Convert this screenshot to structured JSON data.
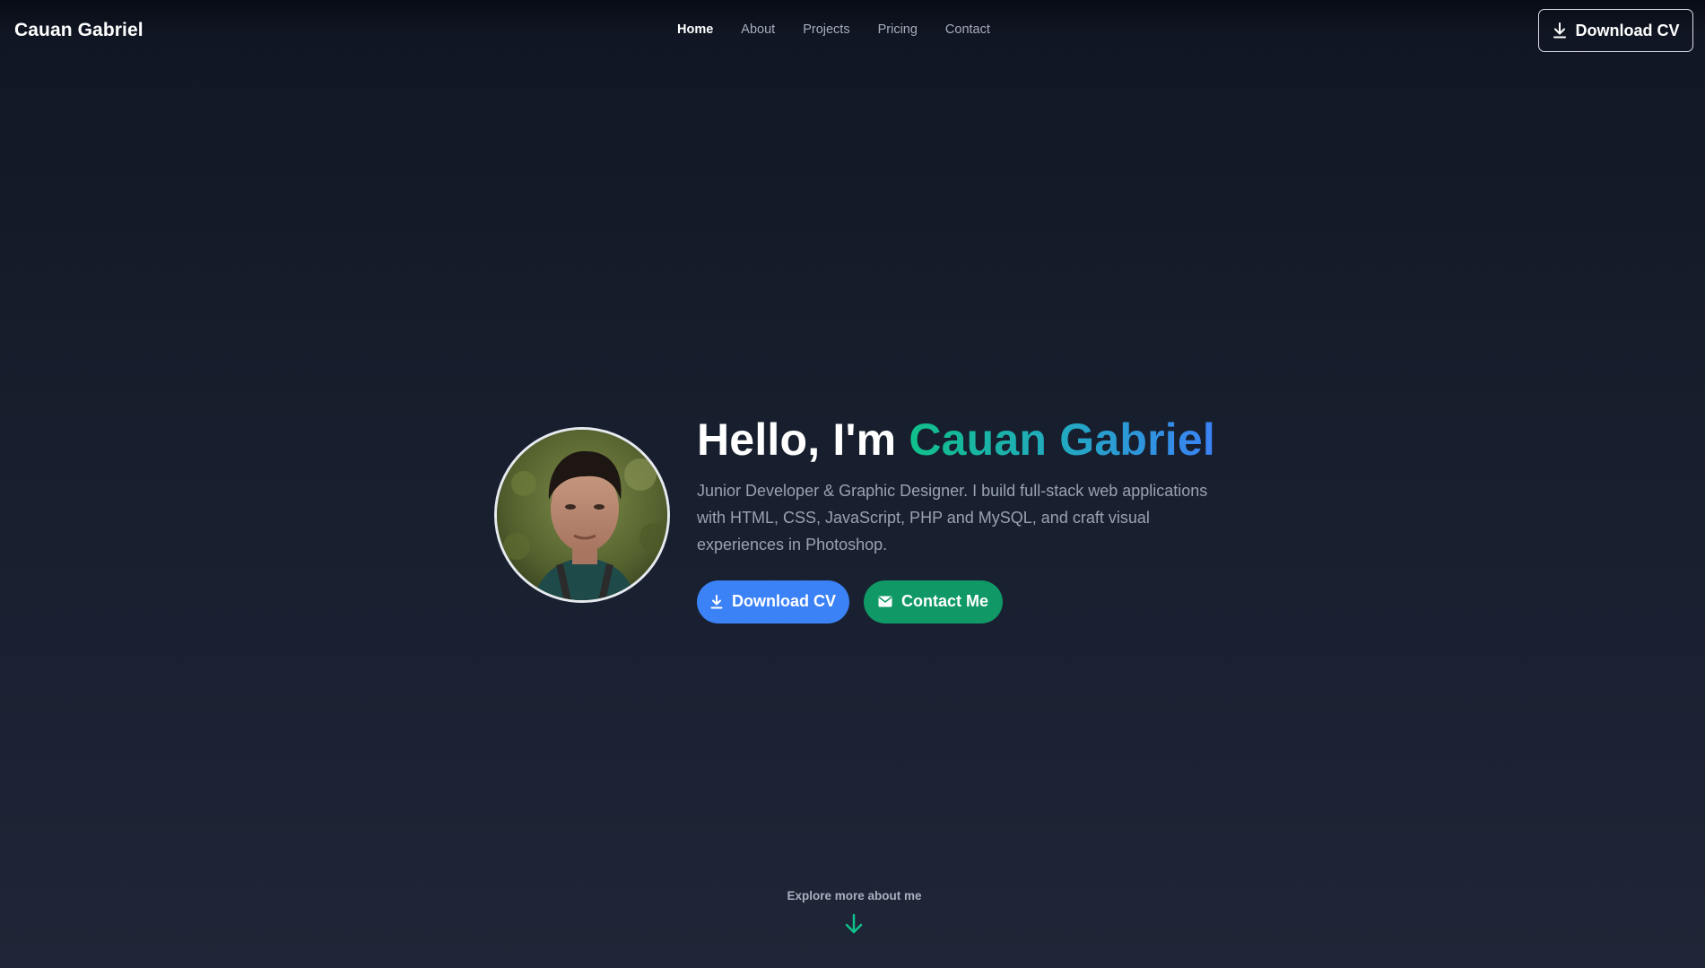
{
  "nav": {
    "brand": "Cauan Gabriel",
    "links": [
      {
        "label": "Home",
        "active": true
      },
      {
        "label": "About",
        "active": false
      },
      {
        "label": "Projects",
        "active": false
      },
      {
        "label": "Pricing",
        "active": false
      },
      {
        "label": "Contact",
        "active": false
      }
    ],
    "cv_button": {
      "label": "Download CV",
      "icon": "download-icon"
    }
  },
  "hero": {
    "greeting": "Hello, I'm ",
    "name": "Cauan Gabriel",
    "description": "Junior Developer & Graphic Designer. I build full-stack web applications with HTML, CSS, JavaScript, PHP and MySQL, and craft visual experiences in Photoshop.",
    "avatar": "profile-photo",
    "buttons": {
      "download_cv": {
        "label": "Download CV",
        "icon": "download-icon",
        "color": "#3b82f6"
      },
      "contact_me": {
        "label": "Contact Me",
        "icon": "mail-icon",
        "color": "#109866"
      }
    }
  },
  "footer_hint": {
    "label": "Explore more about me",
    "icon": "arrow-down-icon",
    "color": "#10c08a"
  },
  "colors": {
    "accent_green": "#10c08a",
    "accent_blue": "#3b82f6",
    "background": "#161d2b"
  }
}
